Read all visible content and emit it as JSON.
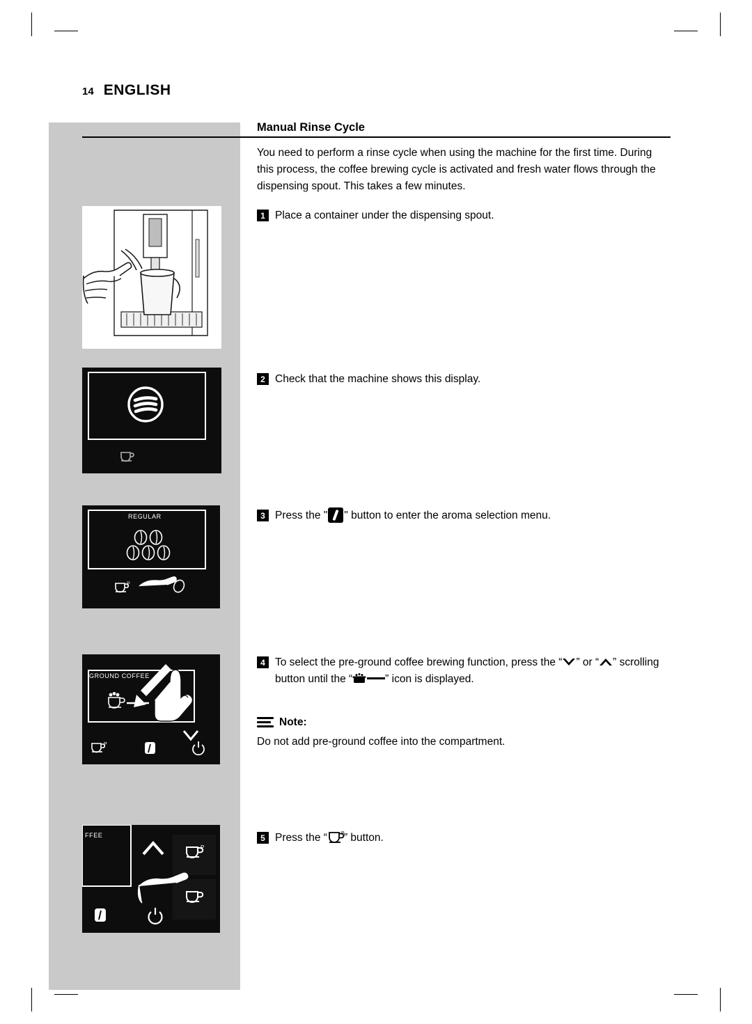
{
  "page": {
    "number": "14",
    "language": "ENGLISH"
  },
  "section": {
    "title": "Manual Rinse Cycle",
    "intro": "You need to perform a rinse cycle when using the machine for the first time. During this process, the coffee brewing cycle is activated and fresh water flows through the dispensing spout. This takes a few minutes."
  },
  "steps": [
    {
      "num": "1",
      "text": "Place a container under the dispensing spout."
    },
    {
      "num": "2",
      "text": "Check that the machine shows this display."
    },
    {
      "num": "3",
      "text_before": "Press the \"",
      "text_after": "\" button to enter the aroma selection menu."
    },
    {
      "num": "4",
      "text_a": "To select the pre-ground coffee brewing function, press the “",
      "text_b": "” or “",
      "text_c": "” scrolling button until the “",
      "text_d": "” icon is displayed."
    },
    {
      "num": "5",
      "text_before": "Press the “",
      "text_after": "” button."
    }
  ],
  "note": {
    "label": "Note:",
    "text": "Do not add pre-ground coffee into the compartment."
  },
  "figures": {
    "fig3_label": "REGULAR",
    "fig4_label": "GROUND COFFEE",
    "fig5_label": "FFEE"
  },
  "icons": {
    "bean": "coffee-bean-icon",
    "chevron_down": "chevron-down-icon",
    "chevron_up": "chevron-up-icon",
    "pre_ground": "pre-ground-coffee-icon",
    "espresso_cup": "espresso-cup-icon",
    "power": "power-icon"
  },
  "colors": {
    "band": "#c9c9c9",
    "lcd": "#0d0d0d",
    "text": "#000000"
  }
}
